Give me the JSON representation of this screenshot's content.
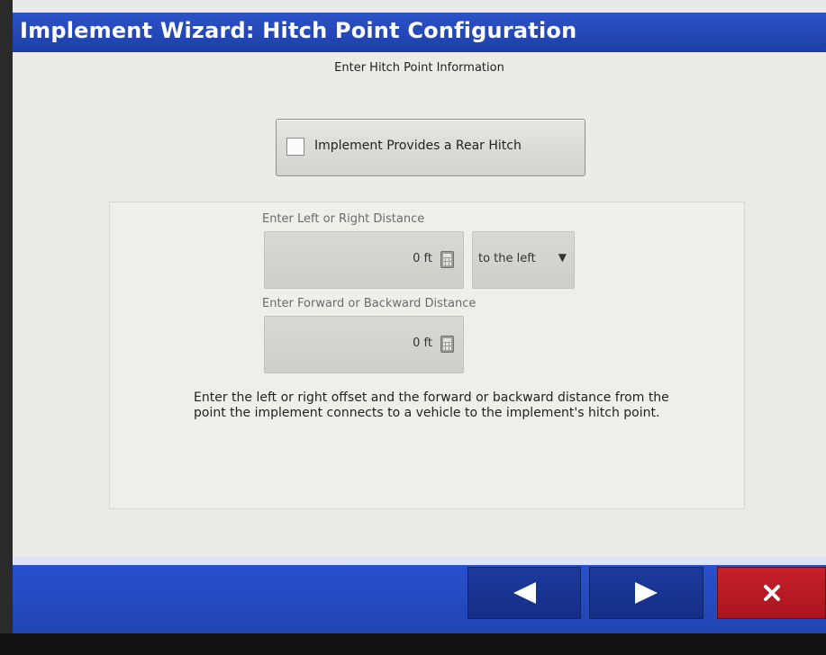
{
  "window": {
    "title": "Implement Wizard:  Hitch Point Configuration",
    "subtitle": "Enter Hitch Point Information"
  },
  "rear_hitch": {
    "label": "Implement Provides a Rear Hitch",
    "checked": false
  },
  "left_right": {
    "label": "Enter Left or Right Distance",
    "value": "0 ft",
    "direction": "to the left",
    "direction_arrow": "▼"
  },
  "forward_backward": {
    "label": "Enter Forward or Backward Distance",
    "value": "0 ft"
  },
  "help_text": "Enter the left or right offset and the forward or backward distance from the point the implement connects to a vehicle to the implement's hitch point.",
  "navigation": {
    "back_icon": "triangle-left-icon",
    "next_icon": "triangle-right-icon",
    "cancel_icon": "close-icon"
  },
  "colors": {
    "title_bar": "#2a4fc4",
    "background": "#ecebe6",
    "nav_button": "#1b3a9e",
    "cancel_button": "#c7202a"
  }
}
